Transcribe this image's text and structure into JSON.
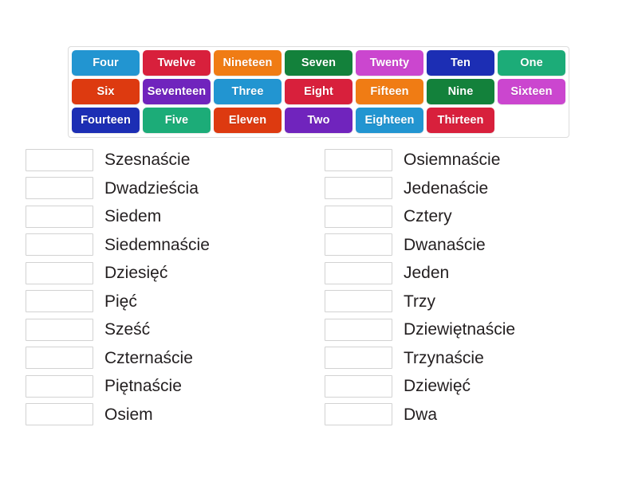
{
  "activity": {
    "type": "match-up",
    "background": "#ffffff",
    "bank_border_color": "#dcdcdc",
    "drop_zone_border_color": "#d2d2d2",
    "label_color": "#231f20"
  },
  "tile_bank": {
    "rows": [
      [
        {
          "label": "Four",
          "color": "#2295d1"
        },
        {
          "label": "Twelve",
          "color": "#d8203c"
        },
        {
          "label": "Nineteen",
          "color": "#f07c14"
        },
        {
          "label": "Seven",
          "color": "#13813b"
        },
        {
          "label": "Twenty",
          "color": "#cb46cf"
        },
        {
          "label": "Ten",
          "color": "#1c2eb4"
        },
        {
          "label": "One",
          "color": "#1cac78"
        }
      ],
      [
        {
          "label": "Six",
          "color": "#dd3a10"
        },
        {
          "label": "Seventeen",
          "color": "#7024bd"
        },
        {
          "label": "Three",
          "color": "#2295d1"
        },
        {
          "label": "Eight",
          "color": "#d8203c"
        },
        {
          "label": "Fifteen",
          "color": "#f07c14"
        },
        {
          "label": "Nine",
          "color": "#13813b"
        },
        {
          "label": "Sixteen",
          "color": "#cb46cf"
        }
      ],
      [
        {
          "label": "Fourteen",
          "color": "#1c2eb4"
        },
        {
          "label": "Five",
          "color": "#1cac78"
        },
        {
          "label": "Eleven",
          "color": "#dd3a10"
        },
        {
          "label": "Two",
          "color": "#7024bd"
        },
        {
          "label": "Eighteen",
          "color": "#2295d1"
        },
        {
          "label": "Thirteen",
          "color": "#d8203c"
        }
      ]
    ]
  },
  "answers": {
    "left_column": [
      {
        "drop_value": "",
        "label": "Szesnaście"
      },
      {
        "drop_value": "",
        "label": "Dwadzieścia"
      },
      {
        "drop_value": "",
        "label": "Siedem"
      },
      {
        "drop_value": "",
        "label": "Siedemnaście"
      },
      {
        "drop_value": "",
        "label": "Dziesięć"
      },
      {
        "drop_value": "",
        "label": "Pięć"
      },
      {
        "drop_value": "",
        "label": "Sześć"
      },
      {
        "drop_value": "",
        "label": "Czternaście"
      },
      {
        "drop_value": "",
        "label": "Piętnaście"
      },
      {
        "drop_value": "",
        "label": "Osiem"
      }
    ],
    "right_column": [
      {
        "drop_value": "",
        "label": "Osiemnaście"
      },
      {
        "drop_value": "",
        "label": "Jedenaście"
      },
      {
        "drop_value": "",
        "label": "Cztery"
      },
      {
        "drop_value": "",
        "label": "Dwanaście"
      },
      {
        "drop_value": "",
        "label": "Jeden"
      },
      {
        "drop_value": "",
        "label": "Trzy"
      },
      {
        "drop_value": "",
        "label": "Dziewiętnaście"
      },
      {
        "drop_value": "",
        "label": "Trzynaście"
      },
      {
        "drop_value": "",
        "label": "Dziewięć"
      },
      {
        "drop_value": "",
        "label": "Dwa"
      }
    ]
  }
}
